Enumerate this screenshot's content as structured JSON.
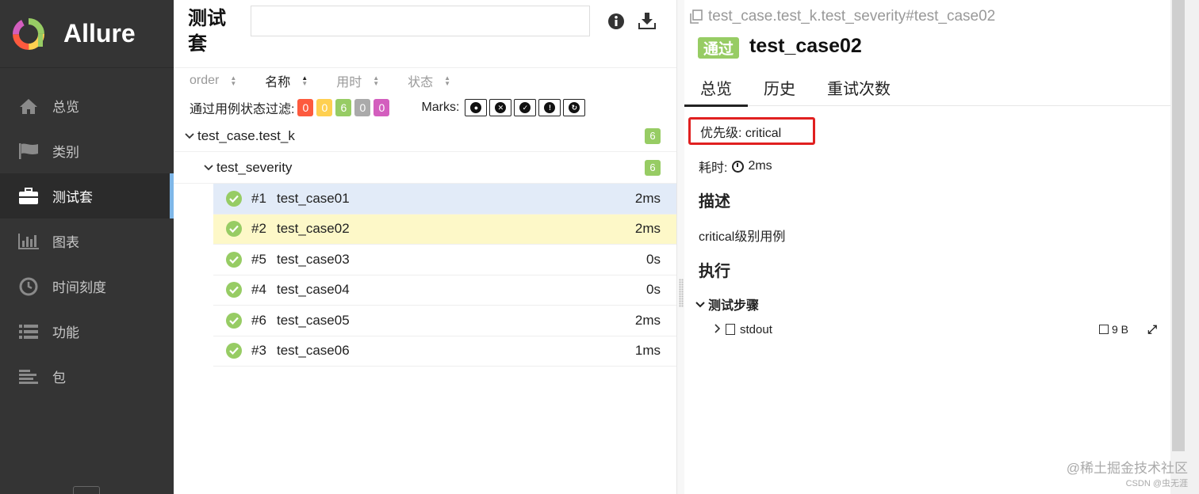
{
  "brand": {
    "name": "Allure",
    "colors": {
      "sidebar": "#343434",
      "accent": "#7fb7e8",
      "passed": "#97cc64"
    }
  },
  "nav": [
    {
      "label": "总览",
      "icon": "home-icon"
    },
    {
      "label": "类别",
      "icon": "flag-icon"
    },
    {
      "label": "测试套",
      "icon": "briefcase-icon",
      "active": true
    },
    {
      "label": "图表",
      "icon": "bar-chart-icon"
    },
    {
      "label": "时间刻度",
      "icon": "clock-icon"
    },
    {
      "label": "功能",
      "icon": "list-icon"
    },
    {
      "label": "包",
      "icon": "align-left-icon"
    }
  ],
  "middle": {
    "title": "测试套",
    "sort": [
      {
        "label": "order"
      },
      {
        "label": "名称",
        "active": true
      },
      {
        "label": "用时"
      },
      {
        "label": "状态"
      }
    ],
    "filter_label": "通过用例状态过滤:",
    "filters": [
      {
        "value": "0",
        "color": "#fd5a3e"
      },
      {
        "value": "0",
        "color": "#ffd050"
      },
      {
        "value": "6",
        "color": "#97cc64"
      },
      {
        "value": "0",
        "color": "#aaaaaa"
      },
      {
        "value": "0",
        "color": "#d35ebe"
      }
    ],
    "marks_label": "Marks:",
    "marks": [
      "bomb-icon",
      "close-circle-icon",
      "check-circle-icon",
      "exclamation-circle-icon",
      "refresh-icon"
    ],
    "groups": [
      {
        "name": "test_case.test_k",
        "count": "6"
      },
      {
        "name": "test_severity",
        "count": "6"
      }
    ],
    "cases": [
      {
        "num": "#1",
        "name": "test_case01",
        "duration": "2ms",
        "state": "selected"
      },
      {
        "num": "#2",
        "name": "test_case02",
        "duration": "2ms",
        "state": "hovered"
      },
      {
        "num": "#5",
        "name": "test_case03",
        "duration": "0s",
        "state": ""
      },
      {
        "num": "#4",
        "name": "test_case04",
        "duration": "0s",
        "state": ""
      },
      {
        "num": "#6",
        "name": "test_case05",
        "duration": "2ms",
        "state": ""
      },
      {
        "num": "#3",
        "name": "test_case06",
        "duration": "1ms",
        "state": ""
      }
    ]
  },
  "detail": {
    "crumb": "test_case.test_k.test_severity#test_case02",
    "status": "通过",
    "title": "test_case02",
    "tabs": [
      "总览",
      "历史",
      "重试次数"
    ],
    "severity": "优先级: critical",
    "duration_label": "耗时:",
    "duration_value": "2ms",
    "desc_heading": "描述",
    "description": "critical级别用例",
    "exec_heading": "执行",
    "steps_heading": "测试步骤",
    "step_name": "stdout",
    "step_size": "9 B"
  },
  "watermark": {
    "line1": "@稀土掘金技术社区",
    "line2": "CSDN @虫无涯"
  }
}
